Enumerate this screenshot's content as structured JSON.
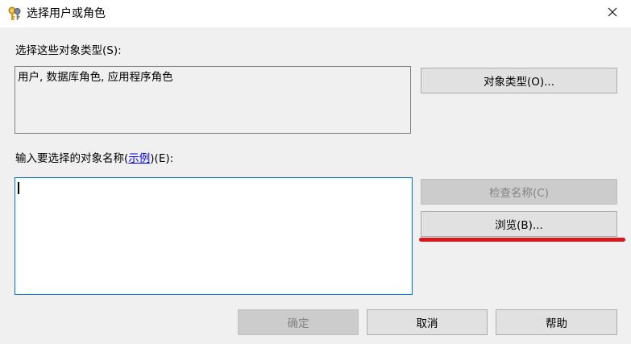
{
  "titlebar": {
    "title": "选择用户或角色",
    "icon": "keys-icon",
    "close_glyph": "✕"
  },
  "object_types": {
    "label": "选择这些对象类型(S):",
    "value": "用户, 数据库角色, 应用程序角色",
    "button_label": "对象类型(O)..."
  },
  "object_names": {
    "label_prefix": "输入要选择的对象名称(",
    "label_link": "示例",
    "label_suffix": ")(E):",
    "value": "",
    "check_names_label": "检查名称(C)",
    "browse_label": "浏览(B)..."
  },
  "footer": {
    "ok_label": "确定",
    "cancel_label": "取消",
    "help_label": "帮助"
  },
  "colors": {
    "annotation_underline": "#d8171d",
    "input_focus_border": "#0078d7",
    "link": "#0000ff"
  }
}
